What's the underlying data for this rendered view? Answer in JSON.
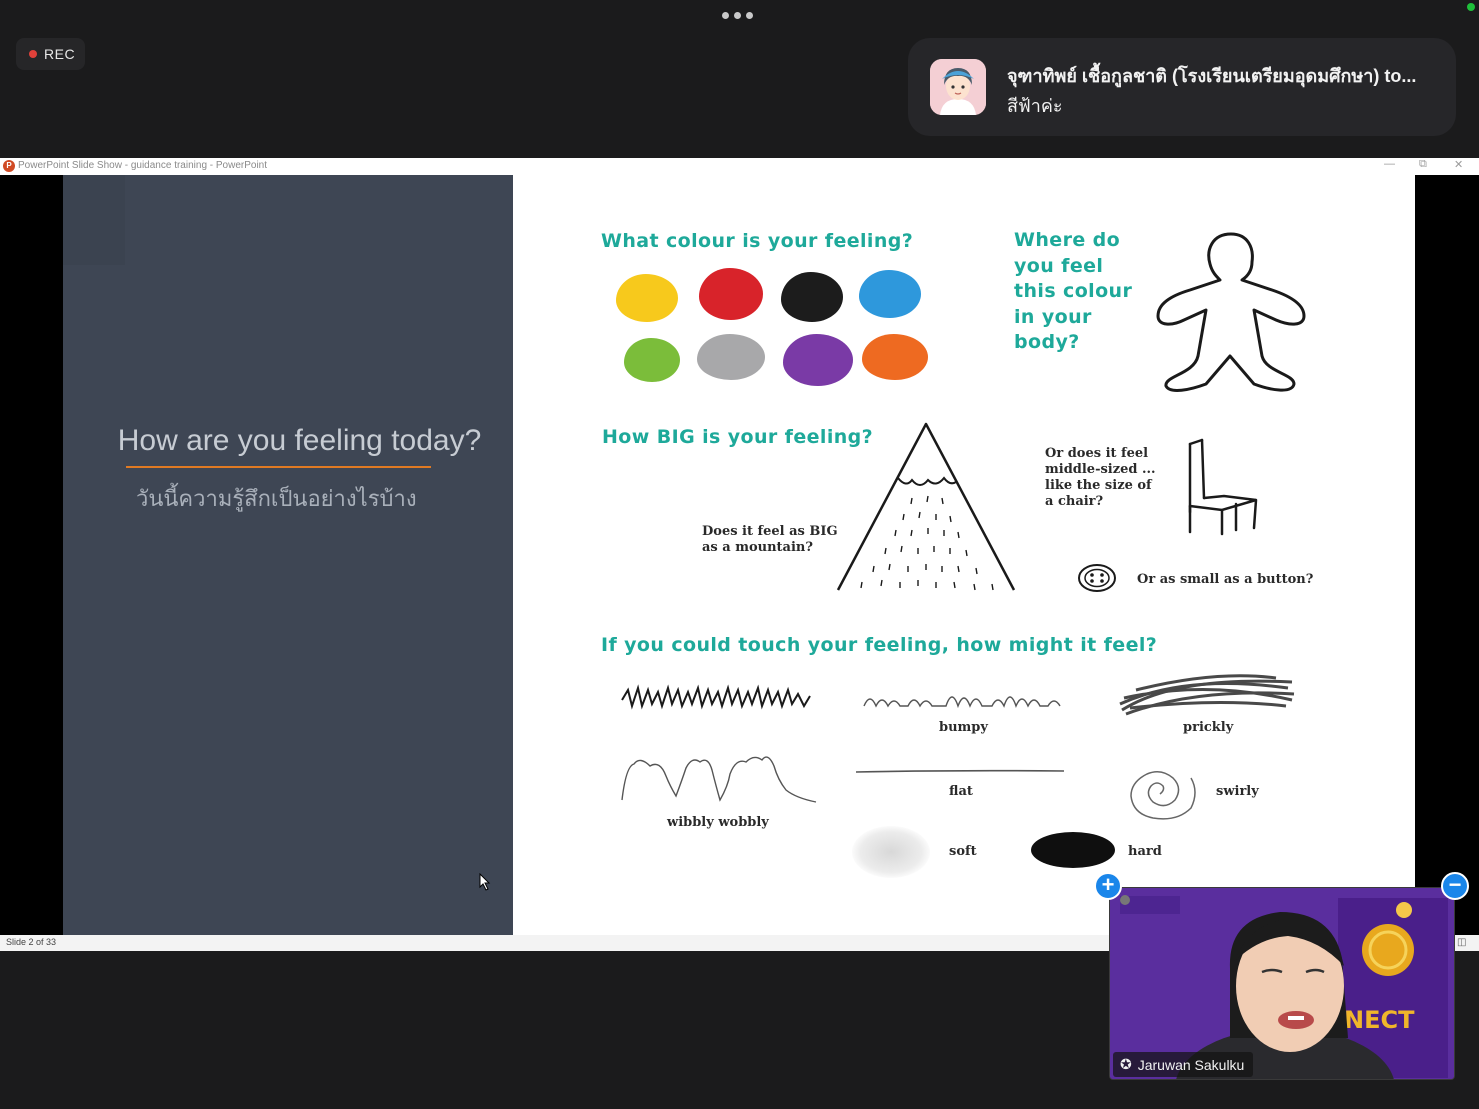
{
  "meeting": {
    "recording_label": "REC",
    "more_icon": "more-dots-icon"
  },
  "chat_toast": {
    "sender": "จุฑาทิพย์ เชื้อกูลชาติ (โรงเรียนเตรียมอุดมศึกษา) to...",
    "message": "สีฟ้าค่ะ"
  },
  "powerpoint": {
    "window_title": "PowerPoint Slide Show  -  guidance training - PowerPoint",
    "slide_status": "Slide 2 of 33",
    "slide": {
      "title": "How are you feeling today?",
      "subtitle": "วันนี้ความรู้สึกเป็นอย่างไรบ้าง",
      "accent_color": "#e07a23",
      "colour_heading": "What colour is your feeling?",
      "colour_swatches": [
        "#f7c91c",
        "#d8232a",
        "#1c1c1c",
        "#2e98dc",
        "#7bbd3a",
        "#a8a8aa",
        "#7a3aa6",
        "#ee6a21"
      ],
      "body_heading": "Where do\nyou feel\nthis colour\nin your\nbody?",
      "size_heading": "How BIG is your feeling?",
      "mountain_text": "Does it feel as BIG\nas a mountain?",
      "chair_text": "Or does it feel\nmiddle-sized ...\nlike the size of\na chair?",
      "button_text": "Or as small as a button?",
      "touch_heading": "If you could touch your feeling, how might it feel?",
      "textures": {
        "bumpy": "bumpy",
        "prickly": "prickly",
        "wibbly": "wibbly wobbly",
        "flat": "flat",
        "swirly": "swirly",
        "soft": "soft",
        "hard": "hard"
      }
    }
  },
  "participant": {
    "name": "Jaruwan Sakulku",
    "background_color": "#5a2e9e"
  }
}
